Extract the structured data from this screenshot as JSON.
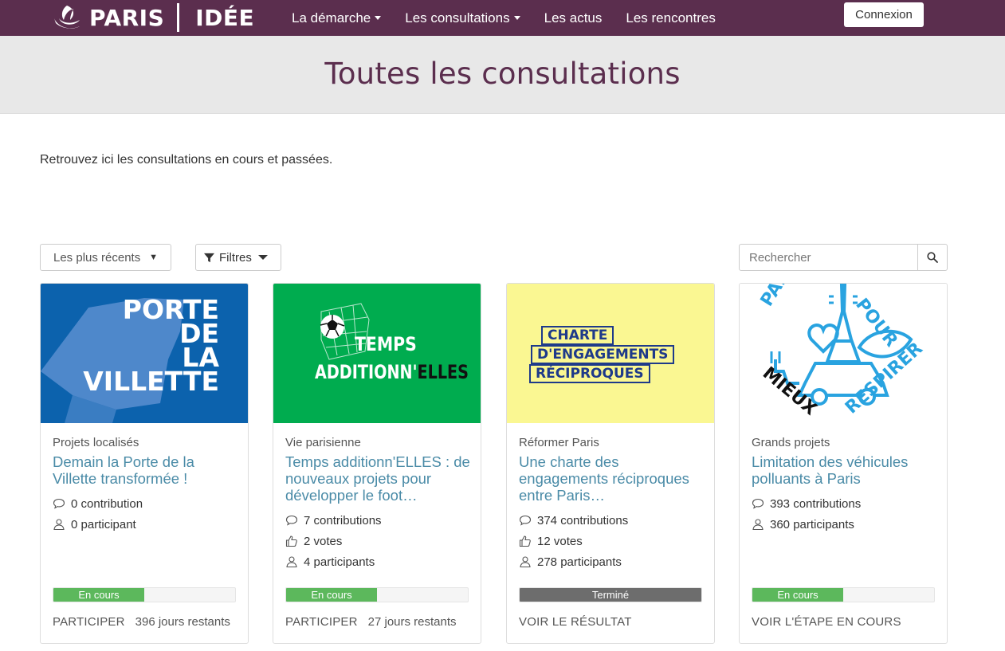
{
  "header": {
    "logo_left": "PARIS",
    "logo_right": "IDÉE",
    "nav": [
      {
        "label": "La démarche",
        "has_dropdown": true
      },
      {
        "label": "Les consultations",
        "has_dropdown": true
      },
      {
        "label": "Les actus",
        "has_dropdown": false
      },
      {
        "label": "Les rencontres",
        "has_dropdown": false
      }
    ],
    "login_label": "Connexion"
  },
  "page": {
    "title": "Toutes les consultations",
    "intro": "Retrouvez ici les consultations en cours et passées."
  },
  "controls": {
    "sort_value": "Les plus récents",
    "filter_label": "Filtres",
    "search_placeholder": "Rechercher"
  },
  "colors": {
    "brand": "#5b2e4e",
    "link": "#4a8ba7",
    "progress_active": "#5cb85c",
    "progress_done": "#6d6d6d"
  },
  "cards": [
    {
      "image": {
        "bg": "#0c62ad",
        "lines": [
          "PORTE",
          "DE",
          "LA",
          "VILLETTE"
        ]
      },
      "category": "Projets localisés",
      "title": "Demain la Porte de la Villette transformée !",
      "stats": {
        "contributions": "0 contribution",
        "participants": "0 participant"
      },
      "status": {
        "label": "En cours",
        "progress": 0.5
      },
      "action": "PARTICIPER",
      "remaining": "396 jours restants"
    },
    {
      "image": {
        "bg": "#00ac4f",
        "lines": [
          "TEMPS",
          "ADDITIONN'",
          "ELLES"
        ]
      },
      "category": "Vie parisienne",
      "title": "Temps additionn'ELLES : de nouveaux projets pour développer le foot…",
      "stats": {
        "contributions": "7 contributions",
        "votes": "2 votes",
        "participants": "4 participants"
      },
      "status": {
        "label": "En cours",
        "progress": 0.5
      },
      "action": "PARTICIPER",
      "remaining": "27 jours restants"
    },
    {
      "image": {
        "bg": "#faf792",
        "lines": [
          "CHARTE",
          "D'ENGAGEMENTS",
          "RÉCIPROQUES"
        ]
      },
      "category": "Réformer Paris",
      "title": "Une charte des engagements réciproques entre Paris…",
      "stats": {
        "contributions": "374 contributions",
        "votes": "12 votes",
        "participants": "278 participants"
      },
      "status": {
        "label": "Terminé",
        "progress": 1.0
      },
      "action": "VOIR LE RÉSULTAT",
      "remaining": ""
    },
    {
      "image": {
        "bg": "#ffffff",
        "top": "PARIS",
        "top_right": "POUR",
        "bottom_left": "MIEUX",
        "bottom_right": "RESPIRER"
      },
      "category": "Grands projets",
      "title": "Limitation des véhicules polluants à Paris",
      "stats": {
        "contributions": "393 contributions",
        "participants": "360 participants"
      },
      "status": {
        "label": "En cours",
        "progress": 0.5
      },
      "action": "VOIR L'ÉTAPE EN COURS",
      "remaining": ""
    }
  ]
}
